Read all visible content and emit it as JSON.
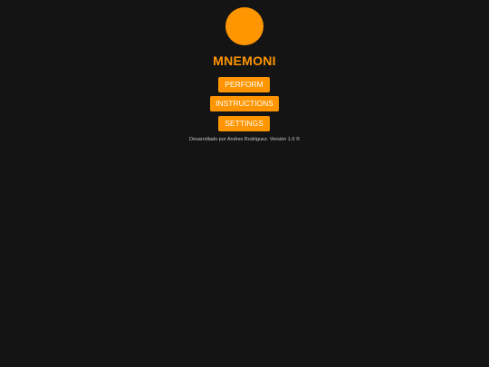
{
  "app": {
    "title": "MNEMONI"
  },
  "menu": {
    "perform_label": "PERFORM",
    "instructions_label": "INSTRUCTIONS",
    "settings_label": "SETTINGS"
  },
  "footer": {
    "credit": "Desarrollado por Andres Rodriguez. Versión 1.0 ©"
  },
  "colors": {
    "accent": "#ff9500",
    "background": "#141414",
    "button_text": "#ffffff",
    "footer_text": "#c8c8c8"
  }
}
